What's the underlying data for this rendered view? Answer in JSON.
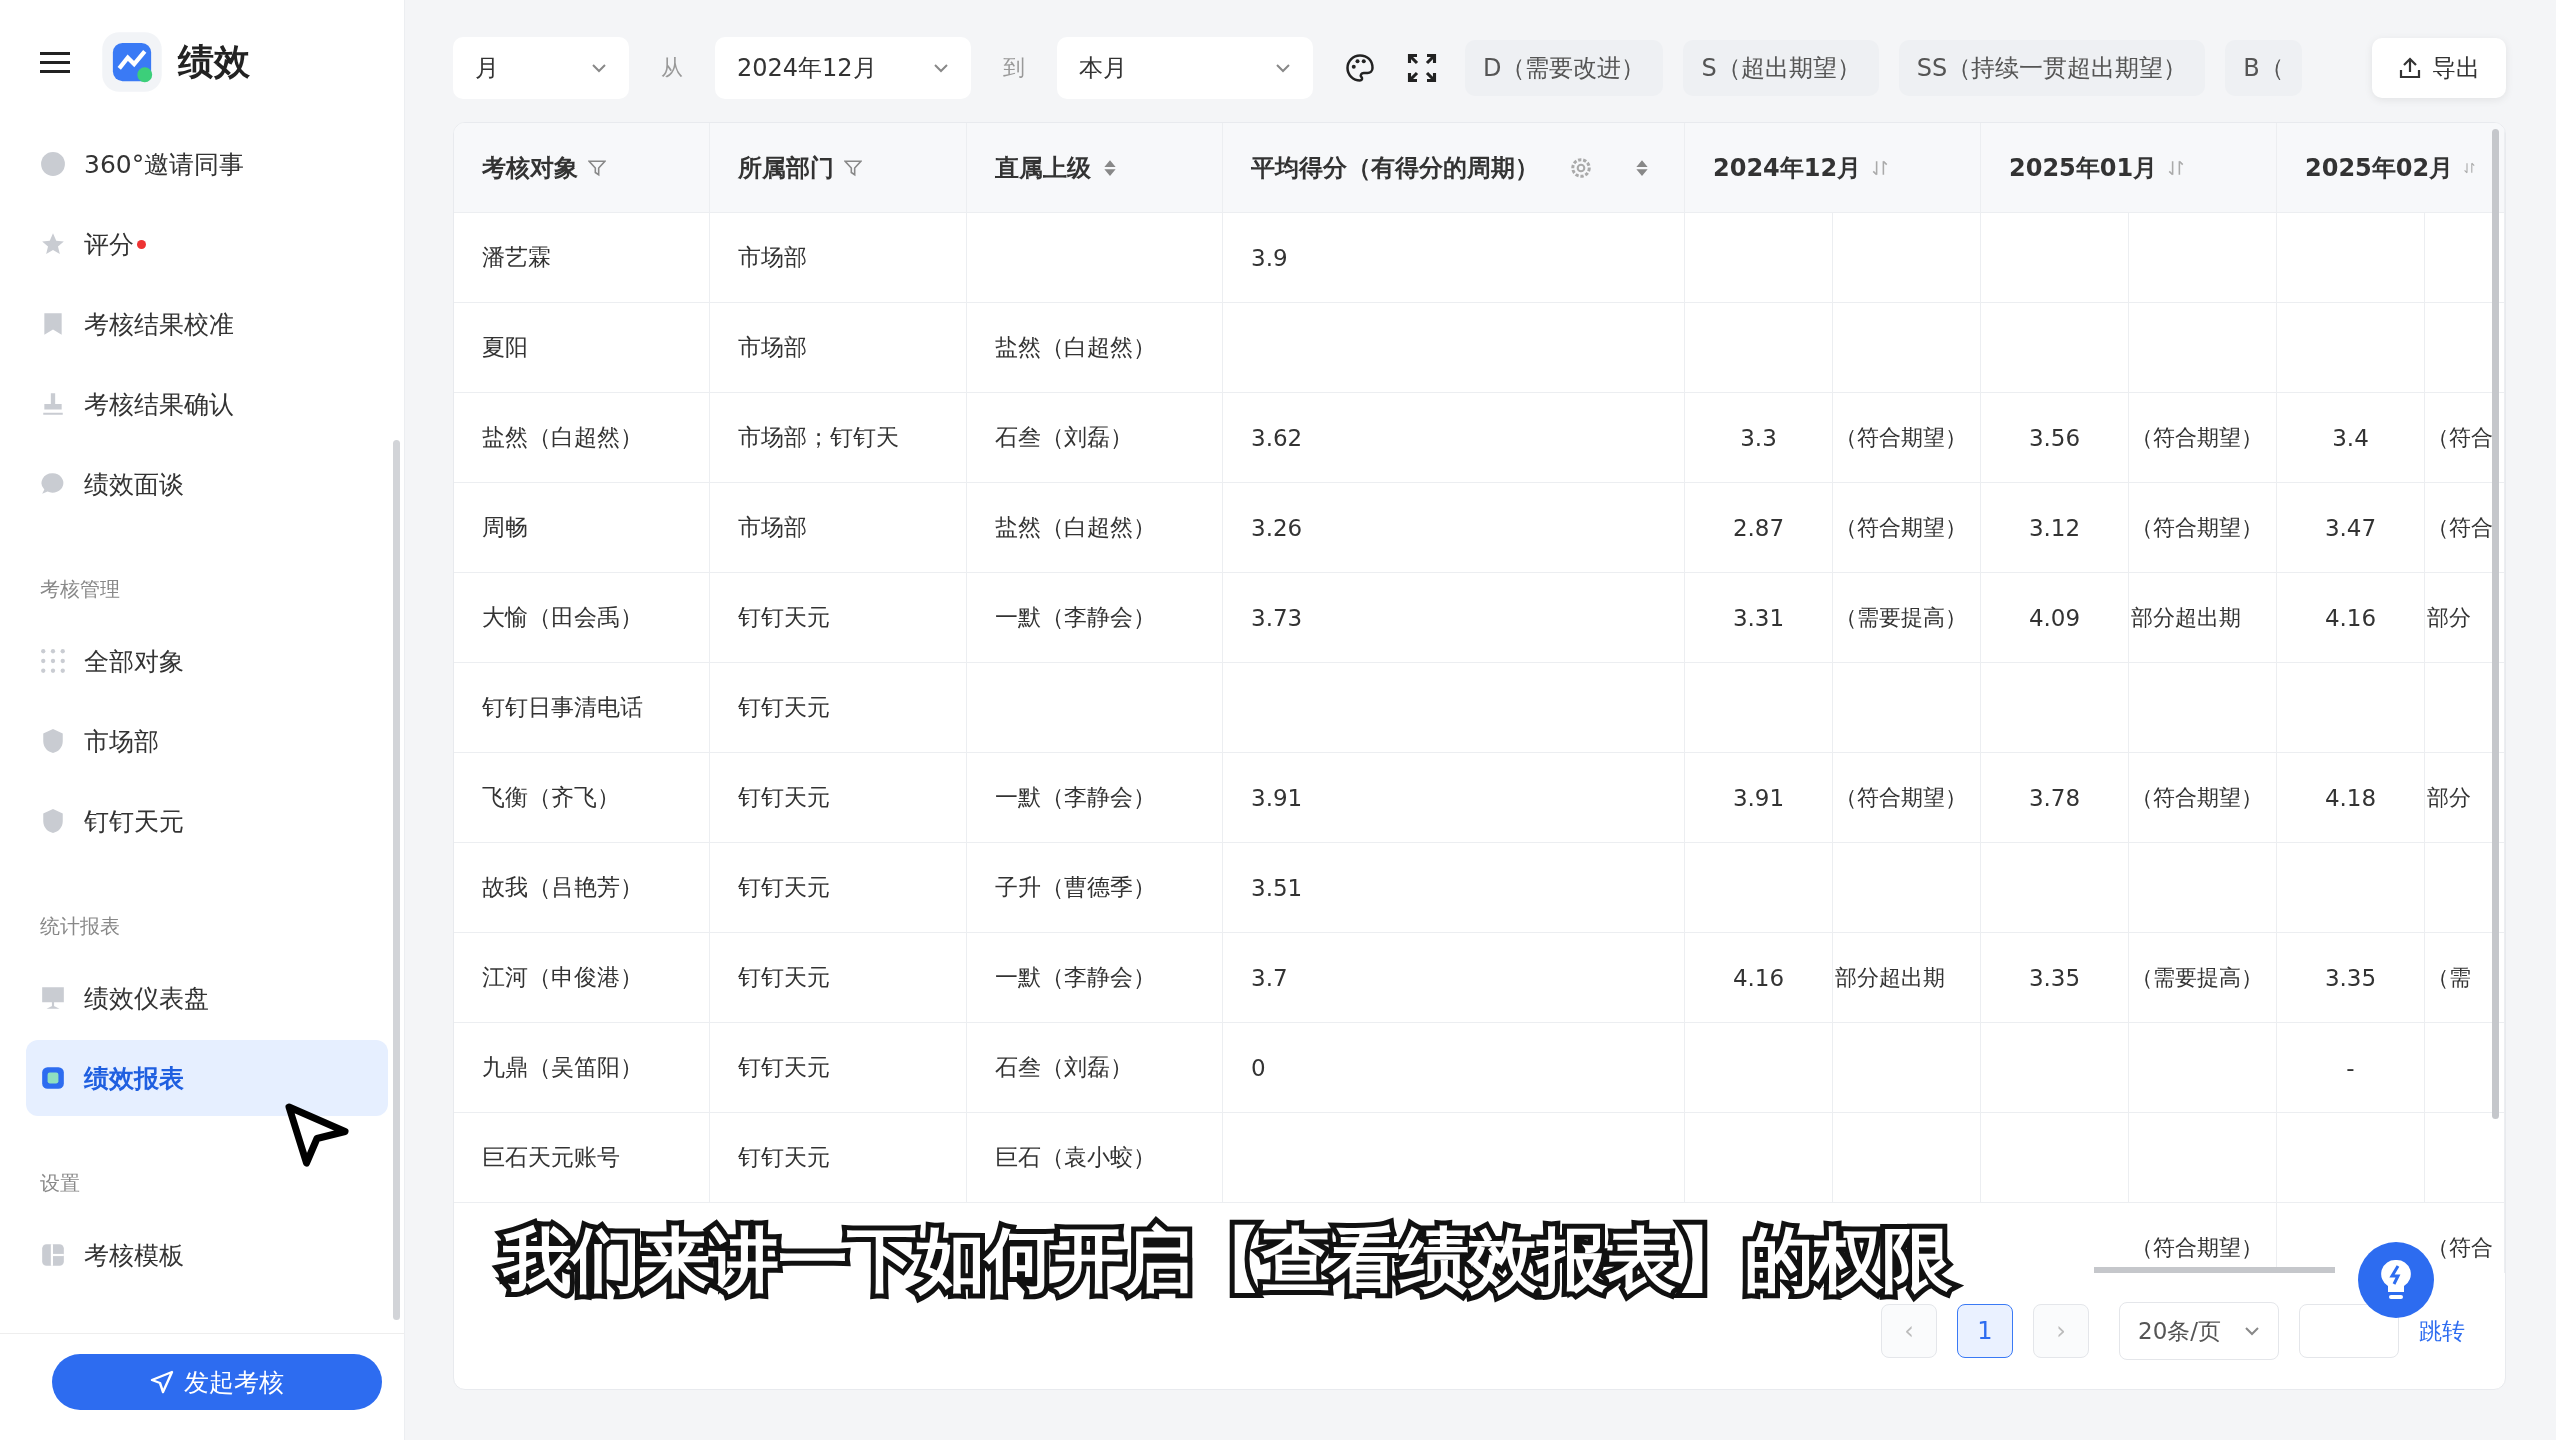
{
  "app": {
    "title": "绩效"
  },
  "sidebar": {
    "items": [
      {
        "kind": "item",
        "label": "360°邀请同事",
        "selected": false,
        "dot": false
      },
      {
        "kind": "item",
        "label": "评分",
        "selected": false,
        "dot": true
      },
      {
        "kind": "item",
        "label": "考核结果校准",
        "selected": false,
        "dot": false
      },
      {
        "kind": "item",
        "label": "考核结果确认",
        "selected": false,
        "dot": false
      },
      {
        "kind": "item",
        "label": "绩效面谈",
        "selected": false,
        "dot": false
      },
      {
        "kind": "section",
        "label": "考核管理"
      },
      {
        "kind": "item",
        "label": "全部对象",
        "selected": false,
        "dot": false
      },
      {
        "kind": "item",
        "label": "市场部",
        "selected": false,
        "dot": false
      },
      {
        "kind": "item",
        "label": "钉钉天元",
        "selected": false,
        "dot": false
      },
      {
        "kind": "section",
        "label": "统计报表"
      },
      {
        "kind": "item",
        "label": "绩效仪表盘",
        "selected": false,
        "dot": false
      },
      {
        "kind": "item",
        "label": "绩效报表",
        "selected": true,
        "dot": false
      },
      {
        "kind": "section",
        "label": "设置"
      },
      {
        "kind": "item",
        "label": "考核模板",
        "selected": false,
        "dot": false
      }
    ],
    "button": "发起考核"
  },
  "toolbar": {
    "period": "月",
    "from_label": "从",
    "from": "2024年12月",
    "to_label": "到",
    "to": "本月",
    "grade_filters": [
      "D（需要改进）",
      "S（超出期望）",
      "SS（持续一贯超出期望）",
      "B（"
    ],
    "export": "导出"
  },
  "table": {
    "columns": [
      {
        "label": "考核对象",
        "kind": "filter"
      },
      {
        "label": "所属部门",
        "kind": "filter"
      },
      {
        "label": "直属上级",
        "kind": "sort"
      },
      {
        "label": "平均得分（有得分的周期）",
        "kind": "settings-sort"
      },
      {
        "label": "2024年12月",
        "kind": "sort-alt"
      },
      {
        "label": "2025年01月",
        "kind": "sort-alt"
      },
      {
        "label": "2025年02月",
        "kind": "sort-alt"
      }
    ],
    "rows": [
      {
        "name": "潘艺霖",
        "department": "市场部",
        "average": "3.9"
      },
      {
        "name": "夏阳",
        "department": "市场部",
        "manager": "盐然（白超然）"
      },
      {
        "name": "盐然（白超然）",
        "department": "市场部；钉钉天",
        "manager": "石叁（刘磊）",
        "average": "3.62",
        "score_2024_12": "3.3",
        "grade_2024_12": "（符合期望）",
        "score_2025_01": "3.56",
        "grade_2025_01": "（符合期望）",
        "score_2025_02": "3.4",
        "grade_2025_02": "（符合"
      },
      {
        "name": "周畅",
        "department": "市场部",
        "manager": "盐然（白超然）",
        "average": "3.26",
        "score_2024_12": "2.87",
        "grade_2024_12": "（符合期望）",
        "score_2025_01": "3.12",
        "grade_2025_01": "（符合期望）",
        "score_2025_02": "3.47",
        "grade_2025_02": "（符合"
      },
      {
        "name": "大愉（田会禹）",
        "department": "钉钉天元",
        "manager": "一默（李静会）",
        "average": "3.73",
        "score_2024_12": "3.31",
        "grade_2024_12": "（需要提高）",
        "score_2025_01": "4.09",
        "grade_2025_01": "部分超出期",
        "score_2025_02": "4.16",
        "grade_2025_02": "部分"
      },
      {
        "name": "钉钉日事清电话",
        "department": "钉钉天元"
      },
      {
        "name": "飞衡（齐飞）",
        "department": "钉钉天元",
        "manager": "一默（李静会）",
        "average": "3.91",
        "score_2024_12": "3.91",
        "grade_2024_12": "（符合期望）",
        "score_2025_01": "3.78",
        "grade_2025_01": "（符合期望）",
        "score_2025_02": "4.18",
        "grade_2025_02": "部分"
      },
      {
        "name": "故我（吕艳芳）",
        "department": "钉钉天元",
        "manager": "子升（曹德季）",
        "average": "3.51"
      },
      {
        "name": "江河（申俊港）",
        "department": "钉钉天元",
        "manager": "一默（李静会）",
        "average": "3.7",
        "score_2024_12": "4.16",
        "grade_2024_12": "部分超出期",
        "score_2025_01": "3.35",
        "grade_2025_01": "（需要提高）",
        "score_2025_02": "3.35",
        "grade_2025_02": "（需"
      },
      {
        "name": "九鼎（吴笛阳）",
        "department": "钉钉天元",
        "manager": "石叁（刘磊）",
        "average": "0",
        "score_2025_02": "-"
      },
      {
        "name": "巨石天元账号",
        "department": "钉钉天元",
        "manager": "巨石（袁小蛟）"
      },
      {
        "grade_2025_01": "（符合期望）",
        "grade_2025_02": "（符合"
      }
    ]
  },
  "pagination": {
    "prev": "‹",
    "pages": [
      {
        "label": "1",
        "selected": true
      }
    ],
    "next": "›",
    "page_size": "20条/页",
    "jump": "跳转"
  },
  "subtitle": "我们来讲一下如何开启【查看绩效报表】的权限"
}
